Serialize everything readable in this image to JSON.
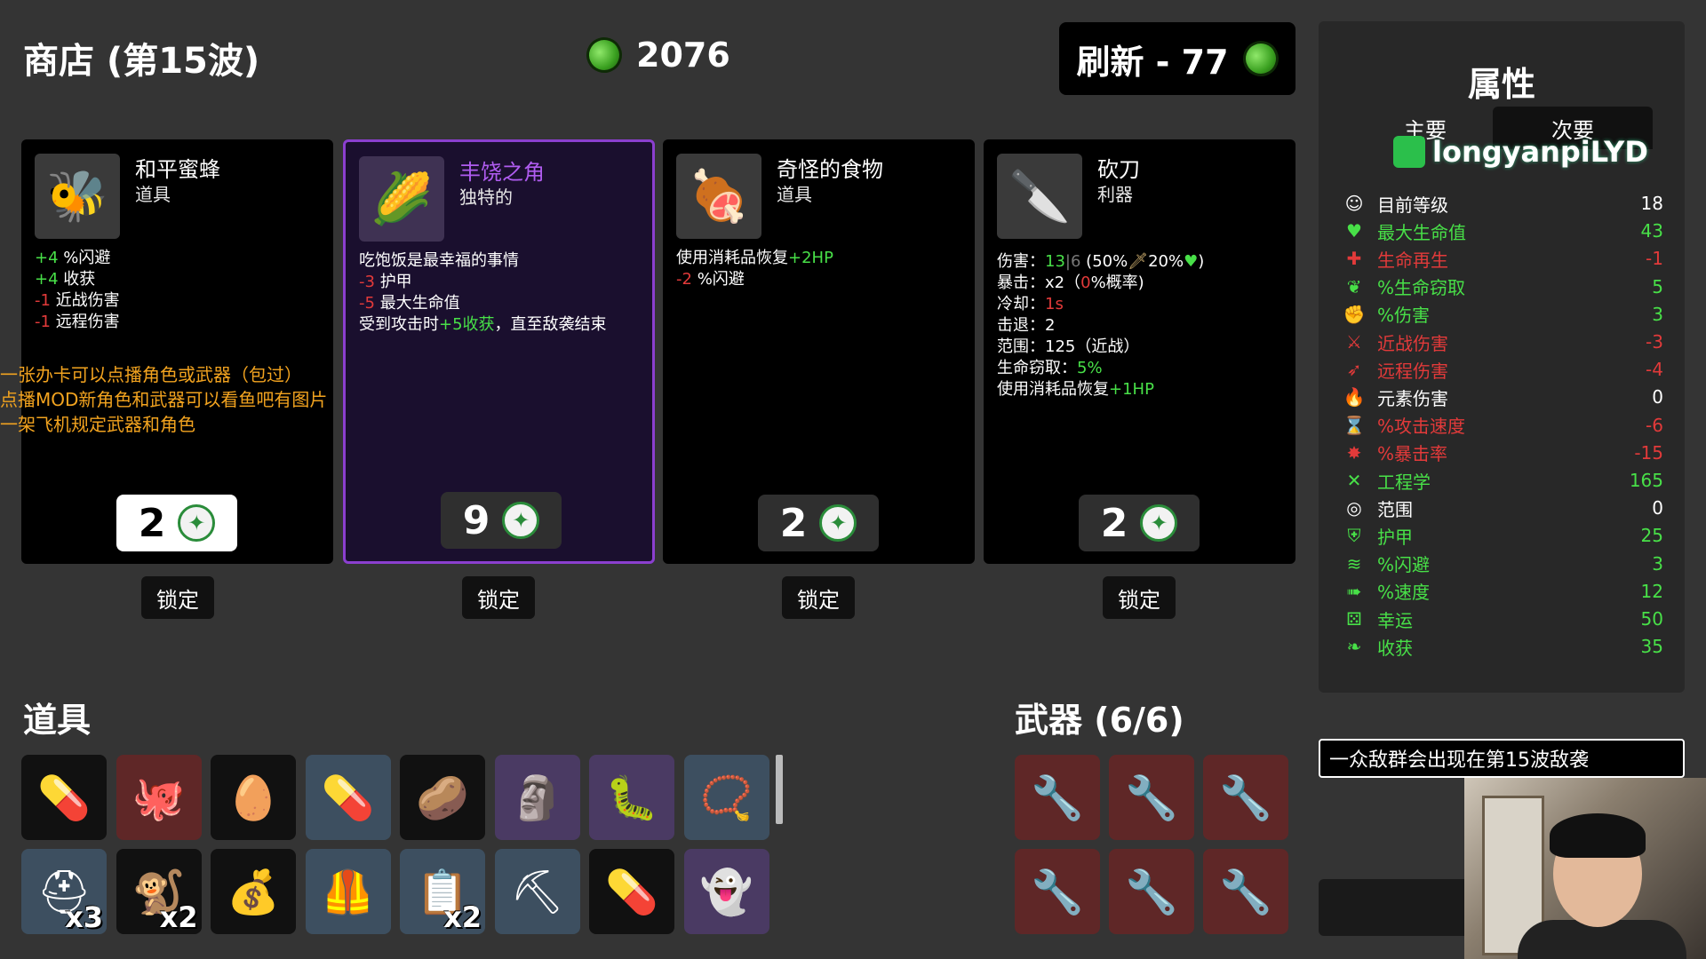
{
  "header": {
    "title": "商店 (第15波)",
    "gold": "2076",
    "refresh_label": "刷新 - 77"
  },
  "shop": {
    "cards": [
      {
        "name": "和平蜜蜂",
        "type": "道具",
        "icon": "bee-icon",
        "stats": [
          {
            "value": "+4",
            "text": "%闪避",
            "color": "green"
          },
          {
            "value": "+4",
            "text": "收获",
            "color": "green"
          },
          {
            "value": "-1",
            "text": "近战伤害",
            "color": "red"
          },
          {
            "value": "-1",
            "text": "远程伤害",
            "color": "red"
          }
        ],
        "price": "2",
        "lock_label": "锁定"
      },
      {
        "name": "丰饶之角",
        "type": "独特的",
        "icon": "cornucopia-icon",
        "line1": "吃饱饭是最幸福的事情",
        "stats": [
          {
            "value": "-3",
            "text": "护甲",
            "color": "red"
          },
          {
            "value": "-5",
            "text": "最大生命值",
            "color": "red"
          }
        ],
        "line_pre": "受到攻击时",
        "line_val": "+5收获",
        "line_post": "，直至敌袭结束",
        "price": "9",
        "lock_label": "锁定"
      },
      {
        "name": "奇怪的食物",
        "type": "道具",
        "icon": "strange-food-icon",
        "line1_pre": "使用消耗品恢复",
        "line1_val": "+2HP",
        "stats": [
          {
            "value": "-2",
            "text": "%闪避",
            "color": "red"
          }
        ],
        "price": "2",
        "lock_label": "锁定"
      },
      {
        "name": "砍刀",
        "type": "利器",
        "icon": "cleaver-icon",
        "damage_label": "伤害：",
        "damage_val": "13",
        "damage_sep": "|",
        "damage_base": "6",
        "damage_scale": "(50%",
        "damage_scale2": "20%",
        "damage_close": ")",
        "crit_label": "暴击：",
        "crit_val": "x2（",
        "crit_chance": "0",
        "crit_post": "%概率)",
        "cooldown_label": "冷却：",
        "cooldown_val": "1s",
        "knockback": "击退：2",
        "range": "范围：125（近战）",
        "lifesteal_label": "生命窃取：",
        "lifesteal_val": "5%",
        "heal_pre": "使用消耗品恢复",
        "heal_val": "+1HP",
        "price": "2",
        "lock_label": "锁定"
      }
    ]
  },
  "overlay_text": [
    "一张办卡可以点播角色或武器（包过）",
    "点播MOD新角色和武器可以看鱼吧有图片",
    "一架飞机规定武器和角色"
  ],
  "items_section": {
    "title": "道具",
    "items": [
      {
        "icon": "blue-pill-icon",
        "tone": "black",
        "count": ""
      },
      {
        "icon": "octopus-icon",
        "tone": "red",
        "count": ""
      },
      {
        "icon": "eye-egg-icon",
        "tone": "black",
        "count": ""
      },
      {
        "icon": "red-pill-icon",
        "tone": "blue",
        "count": ""
      },
      {
        "icon": "potato-face-icon",
        "tone": "black",
        "count": ""
      },
      {
        "icon": "totem-icon",
        "tone": "purple",
        "count": ""
      },
      {
        "icon": "tardigrade-icon",
        "tone": "purple",
        "count": ""
      },
      {
        "icon": "pendant-icon",
        "tone": "blue",
        "count": ""
      },
      {
        "icon": "helmet-icon",
        "tone": "blue",
        "count": "x3"
      },
      {
        "icon": "monkey-icon",
        "tone": "black",
        "count": "x2"
      },
      {
        "icon": "sack-icon",
        "tone": "black",
        "count": ""
      },
      {
        "icon": "vest-icon",
        "tone": "blue",
        "count": ""
      },
      {
        "icon": "checklist-icon",
        "tone": "blue",
        "count": "x2"
      },
      {
        "icon": "shovel-icon",
        "tone": "blue",
        "count": ""
      },
      {
        "icon": "green-pill-icon",
        "tone": "black",
        "count": ""
      },
      {
        "icon": "ghost-cat-icon",
        "tone": "purple",
        "count": ""
      }
    ]
  },
  "weapons_section": {
    "title": "武器 (6/6)",
    "weapons": [
      {
        "icon": "wrench-icon"
      },
      {
        "icon": "wrench-icon"
      },
      {
        "icon": "wrench-icon"
      },
      {
        "icon": "wrench-icon"
      },
      {
        "icon": "wrench-icon"
      },
      {
        "icon": "wrench-icon"
      }
    ]
  },
  "stats_panel": {
    "title": "属性",
    "tab_main": "主要",
    "tab_secondary": "次要",
    "watermark": "longyanpiLYD",
    "rows": [
      {
        "icon": "level-icon",
        "name": "目前等级",
        "value": "18",
        "color": "white"
      },
      {
        "icon": "heart-icon",
        "name": "最大生命值",
        "value": "43",
        "color": "green"
      },
      {
        "icon": "regen-icon",
        "name": "生命再生",
        "value": "-1",
        "color": "red"
      },
      {
        "icon": "lifesteal-icon",
        "name": "%生命窃取",
        "value": "5",
        "color": "green"
      },
      {
        "icon": "damage-icon",
        "name": "%伤害",
        "value": "3",
        "color": "green"
      },
      {
        "icon": "melee-icon",
        "name": "近战伤害",
        "value": "-3",
        "color": "red"
      },
      {
        "icon": "ranged-icon",
        "name": "远程伤害",
        "value": "-4",
        "color": "red"
      },
      {
        "icon": "flame-icon",
        "name": "元素伤害",
        "value": "0",
        "color": "white"
      },
      {
        "icon": "hourglass-icon",
        "name": "%攻击速度",
        "value": "-6",
        "color": "red"
      },
      {
        "icon": "crit-icon",
        "name": "%暴击率",
        "value": "-15",
        "color": "red"
      },
      {
        "icon": "engineering-icon",
        "name": "工程学",
        "value": "165",
        "color": "green"
      },
      {
        "icon": "range-icon",
        "name": "范围",
        "value": "0",
        "color": "white"
      },
      {
        "icon": "armor-icon",
        "name": "护甲",
        "value": "25",
        "color": "green"
      },
      {
        "icon": "dodge-icon",
        "name": "%闪避",
        "value": "3",
        "color": "green"
      },
      {
        "icon": "speed-icon",
        "name": "%速度",
        "value": "12",
        "color": "green"
      },
      {
        "icon": "luck-icon",
        "name": "幸运",
        "value": "50",
        "color": "green"
      },
      {
        "icon": "harvest-icon",
        "name": "收获",
        "value": "35",
        "color": "green"
      }
    ]
  },
  "tooltip": "一众敌群会出现在第15波敌袭",
  "colors": {
    "green": "#48e048",
    "red": "#e23a3a",
    "purple_accent": "#b05cf0",
    "white": "#ffffff"
  }
}
